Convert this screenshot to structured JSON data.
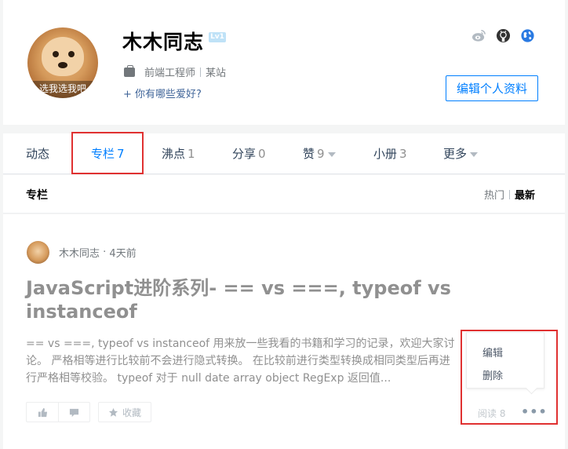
{
  "profile": {
    "avatar_caption": "选我选我吧",
    "name": "木木同志",
    "level": "Lv1",
    "job_title": "前端工程师",
    "company": "某站",
    "hobby_prompt": "+ 你有哪些爱好?",
    "edit_label": "编辑个人资料",
    "social_icons": [
      "weibo-icon",
      "github-icon",
      "globe-icon"
    ]
  },
  "tabs": [
    {
      "label": "动态",
      "count": "",
      "active": false
    },
    {
      "label": "专栏",
      "count": "7",
      "active": true
    },
    {
      "label": "沸点",
      "count": "1",
      "active": false
    },
    {
      "label": "分享",
      "count": "0",
      "active": false
    },
    {
      "label": "赞",
      "count": "9",
      "active": false,
      "dropdown": true
    },
    {
      "label": "小册",
      "count": "3",
      "active": false
    },
    {
      "label": "更多",
      "count": "",
      "active": false,
      "dropdown": true
    }
  ],
  "column_header": {
    "title": "专栏",
    "sort_hot": "热门",
    "sort_new": "最新"
  },
  "article": {
    "author": "木木同志",
    "time": "4天前",
    "title": "JavaScript进阶系列- == vs ===, typeof vs instanceof",
    "abstract": "== vs ===, typeof vs instanceof 用来放一些我看的书籍和学习的记录，欢迎大家讨论。 严格相等进行比较前不会进行隐式转换。 在比较前进行类型转换成相同类型后再进行严格相等校验。 typeof 对于 null date array object RegExp 返回值...",
    "collect_label": "收藏",
    "reads": "阅读 8"
  },
  "popup_menu": {
    "edit": "编辑",
    "delete": "删除"
  },
  "colors": {
    "accent": "#007fff",
    "highlight_box": "#e03131"
  }
}
